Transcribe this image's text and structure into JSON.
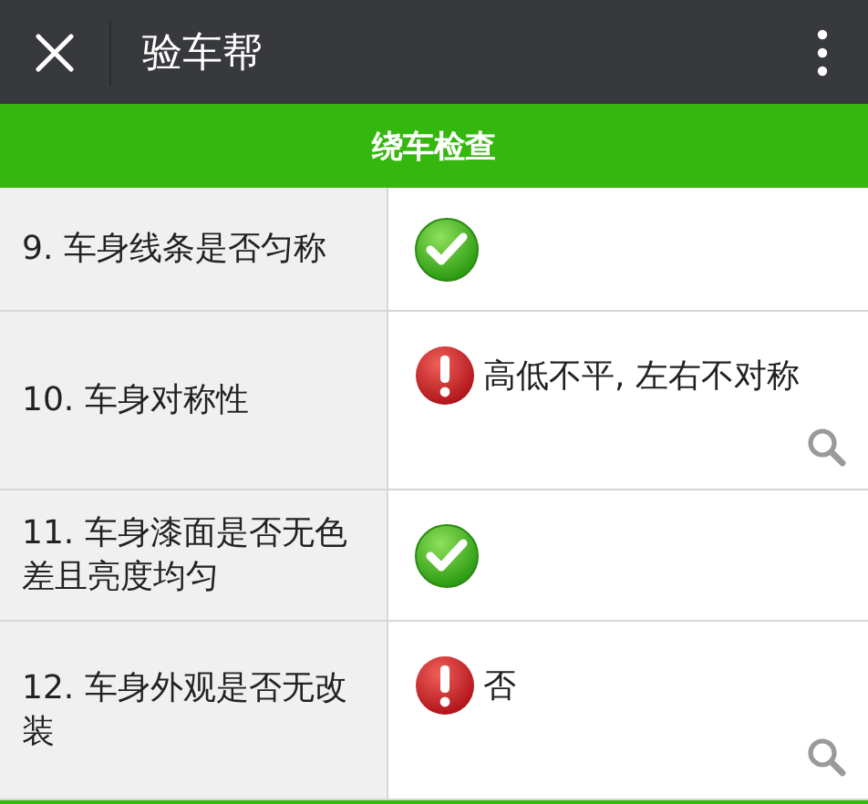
{
  "header": {
    "title": "验车帮"
  },
  "section": {
    "title": "绕车检查"
  },
  "items": [
    {
      "label": "9. 车身线条是否匀称",
      "kind": "pass"
    },
    {
      "label": "10. 车身对称性",
      "kind": "fail",
      "note": "高低不平, 左右不对称"
    },
    {
      "label": "11. 车身漆面是否无色差且亮度均匀",
      "kind": "pass"
    },
    {
      "label": "12. 车身外观是否无改装",
      "kind": "fail",
      "note": "否"
    }
  ]
}
